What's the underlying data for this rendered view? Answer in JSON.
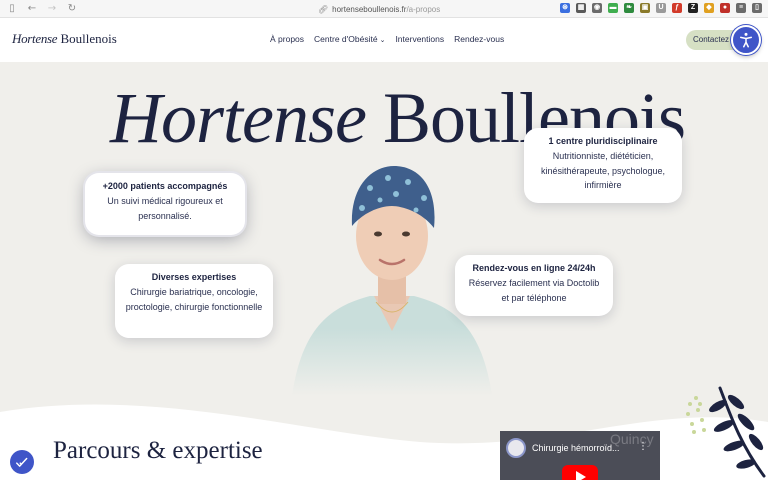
{
  "browser": {
    "url_host": "hortenseboullenois.fr",
    "url_path": "/a-propos",
    "extensions": [
      {
        "name": "ext-blue",
        "color": "#3b6fe0",
        "glyph": "⊛"
      },
      {
        "name": "ext-grid",
        "color": "#5a5a5a",
        "glyph": "▦"
      },
      {
        "name": "ext-camera",
        "color": "#6b6b6b",
        "glyph": "◉"
      },
      {
        "name": "ext-green",
        "color": "#3fae4f",
        "glyph": "▬"
      },
      {
        "name": "ext-leaf",
        "color": "#2e8b3e",
        "glyph": "❧"
      },
      {
        "name": "ext-card",
        "color": "#8a7a2a",
        "glyph": "▣"
      },
      {
        "name": "ext-u",
        "color": "#9a9a9a",
        "glyph": "U"
      },
      {
        "name": "ext-red",
        "color": "#d23a2a",
        "glyph": "ƒ"
      },
      {
        "name": "ext-z",
        "color": "#222222",
        "glyph": "Z"
      },
      {
        "name": "ext-multi",
        "color": "#e0a020",
        "glyph": "◆"
      },
      {
        "name": "ext-red2",
        "color": "#c0302a",
        "glyph": "●"
      },
      {
        "name": "ext-list",
        "color": "#6b6b6b",
        "glyph": "≡"
      },
      {
        "name": "ext-sidebar",
        "color": "#6b6b6b",
        "glyph": "▯"
      }
    ]
  },
  "header": {
    "logo_first": "Hortense",
    "logo_last": "Boullenois",
    "nav": [
      {
        "label": "À propos"
      },
      {
        "label": "Centre d'Obésité",
        "chevron": "⌄"
      },
      {
        "label": "Interventions"
      },
      {
        "label": "Rendez-vous"
      }
    ],
    "contact_label": "Contactez"
  },
  "hero": {
    "title_first": "Hortense",
    "title_last": "Boullenois",
    "cards": [
      {
        "title": "+2000 patients accompagnés",
        "body": "Un suivi médical rigoureux et personnalisé."
      },
      {
        "title": "Diverses expertises",
        "body": "Chirurgie bariatrique, oncologie, proctologie, chirurgie fonctionnelle"
      },
      {
        "title": "1 centre pluridisciplinaire",
        "body": "Nutritionniste, diététicien, kinésithérapeute, psychologue, infirmière"
      },
      {
        "title": "Rendez-vous en ligne 24/24h",
        "body": "Réservez facilement via Doctolib et par téléphone"
      }
    ]
  },
  "section": {
    "title": "Parcours & expertise"
  },
  "video": {
    "title": "Chirurgie hémorroïd...",
    "watermark": "Quincy"
  },
  "colors": {
    "navy": "#1d2340",
    "accent_blue": "#3f55c8",
    "contact_bg": "#d6e0c4",
    "hero_bg": "#f0efeb"
  }
}
